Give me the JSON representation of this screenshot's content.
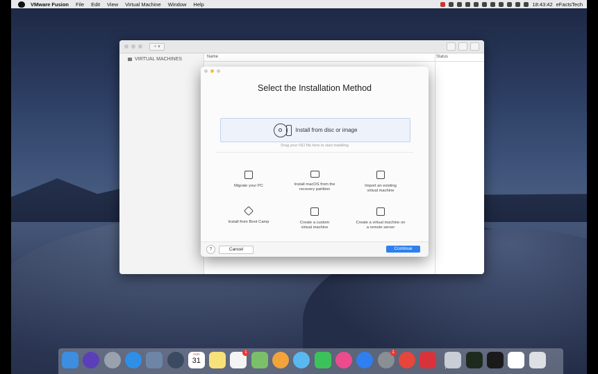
{
  "menubar": {
    "app_name": "VMware Fusion",
    "menus": [
      "File",
      "Edit",
      "View",
      "Virtual Machine",
      "Window",
      "Help"
    ],
    "clock": "18:43:42",
    "user": "eFactsTech",
    "status_icons": [
      "vmware-icon",
      "record-icon",
      "finder-sync-icon",
      "circle-icon",
      "shield-icon",
      "heart-icon",
      "clock-icon",
      "check-icon",
      "wifi-icon",
      "volume-icon",
      "battery-icon"
    ]
  },
  "library": {
    "sidebar_header": "VIRTUAL MACHINES",
    "col_name": "Name",
    "col_status": "Status",
    "add_label": "+ ▾"
  },
  "dialog": {
    "title": "Select the Installation Method",
    "primary_option": "Install from disc or image",
    "drag_hint": "Drag your ISO file here to start installing",
    "options": [
      {
        "label_1": "Migrate your PC",
        "label_2": "",
        "icon": "monitor-arrow-icon"
      },
      {
        "label_1": "Install macOS from the",
        "label_2": "recovery partition",
        "icon": "laptop-icon"
      },
      {
        "label_1": "Import an existing",
        "label_2": "virtual machine",
        "icon": "import-vm-icon"
      },
      {
        "label_1": "Install from Boot Camp",
        "label_2": "",
        "icon": "bootcamp-icon"
      },
      {
        "label_1": "Create a custom",
        "label_2": "virtual machine",
        "icon": "custom-vm-icon"
      },
      {
        "label_1": "Create a virtual machine on",
        "label_2": "a remote server",
        "icon": "remote-server-icon"
      }
    ],
    "help": "?",
    "cancel": "Cancel",
    "continue": "Continue"
  },
  "dock": {
    "items": [
      {
        "name": "finder-icon",
        "color": "#3d8de0"
      },
      {
        "name": "siri-icon",
        "color": "#5a3fb8"
      },
      {
        "name": "launchpad-icon",
        "color": "#9aa3ad"
      },
      {
        "name": "safari-icon",
        "color": "#2f8fe6"
      },
      {
        "name": "preview-icon",
        "color": "#6d86a8"
      },
      {
        "name": "quicktime-icon",
        "color": "#3a4a60"
      },
      {
        "name": "calendar-icon",
        "color": "#ffffff",
        "month": "AUG",
        "day": "31"
      },
      {
        "name": "notes-icon",
        "color": "#f7e27a"
      },
      {
        "name": "reminders-icon",
        "color": "#f4f4f4",
        "badge": "1"
      },
      {
        "name": "maps-icon",
        "color": "#7cbf6a"
      },
      {
        "name": "photos-icon",
        "color": "#f2a43a"
      },
      {
        "name": "messages-icon",
        "color": "#5ab8f0"
      },
      {
        "name": "facetime-icon",
        "color": "#3cc25a"
      },
      {
        "name": "itunes-icon",
        "color": "#ec4b8d"
      },
      {
        "name": "app-store-icon",
        "color": "#2f7ff0"
      },
      {
        "name": "system-preferences-icon",
        "color": "#8a8f96",
        "badge": "1"
      },
      {
        "name": "chrome-icon",
        "color": "#e8453c"
      },
      {
        "name": "vmware-fusion-icon",
        "color": "#d8333a"
      },
      {
        "name": "script-editor-icon",
        "color": "#c9ced6"
      },
      {
        "name": "activity-monitor-icon",
        "color": "#1f2a1f"
      },
      {
        "name": "terminal-icon",
        "color": "#1a1a1a"
      },
      {
        "name": "desktop-stack-icon",
        "color": "#ffffff"
      },
      {
        "name": "trash-icon",
        "color": "#dcdfe3"
      }
    ]
  }
}
